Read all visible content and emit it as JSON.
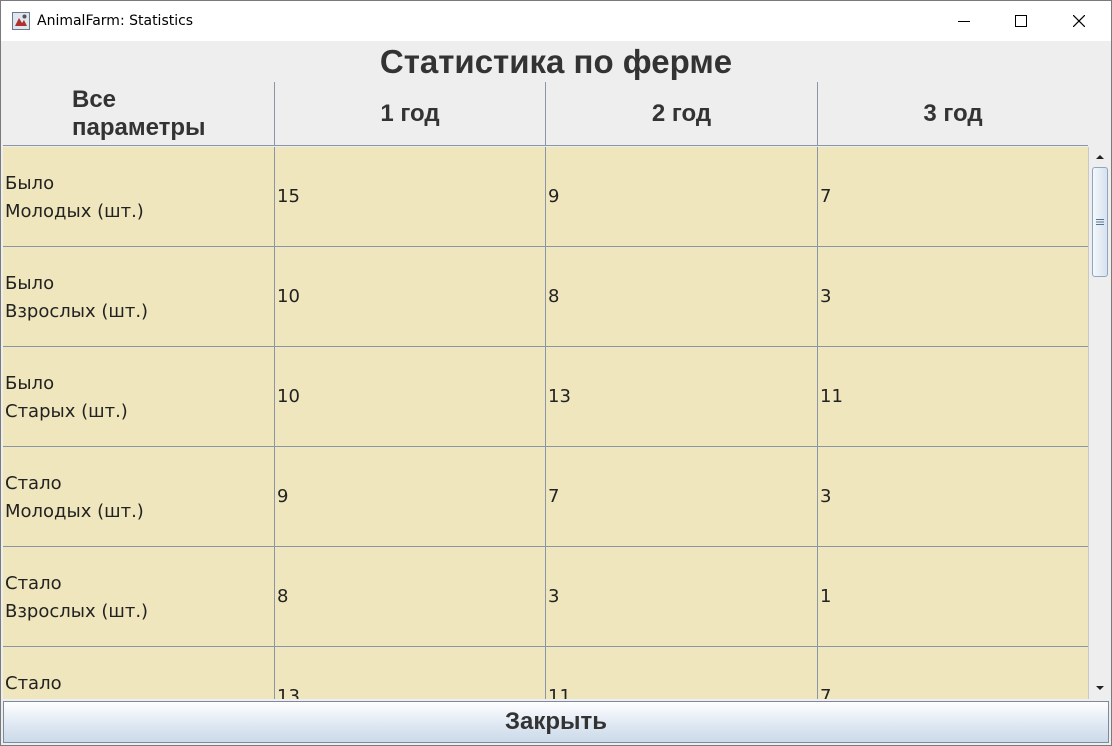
{
  "window": {
    "title": "AnimalFarm: Statistics"
  },
  "heading": "Статистика по ферме",
  "table": {
    "columns": [
      {
        "line1": "Все",
        "line2": "параметры"
      },
      {
        "label": "1 год"
      },
      {
        "label": "2 год"
      },
      {
        "label": "3 год"
      }
    ],
    "rows": [
      {
        "line1": "Было",
        "line2": "Молодых (шт.)",
        "values": [
          "15",
          "9",
          "7"
        ]
      },
      {
        "line1": "Было",
        "line2": "Взрослых (шт.)",
        "values": [
          "10",
          "8",
          "3"
        ]
      },
      {
        "line1": "Было",
        "line2": "Старых (шт.)",
        "values": [
          "10",
          "13",
          "11"
        ]
      },
      {
        "line1": "Стало",
        "line2": "Молодых (шт.)",
        "values": [
          "9",
          "7",
          "3"
        ]
      },
      {
        "line1": "Стало",
        "line2": "Взрослых (шт.)",
        "values": [
          "8",
          "3",
          "1"
        ]
      },
      {
        "line1": "Стало",
        "line2": "",
        "values": [
          "13",
          "11",
          "7"
        ]
      }
    ]
  },
  "close_button": {
    "label": "Закрыть"
  },
  "icons": {
    "app": "animalfarm-app-icon",
    "minimize": "minimize-icon",
    "maximize": "maximize-icon",
    "close": "close-icon"
  }
}
